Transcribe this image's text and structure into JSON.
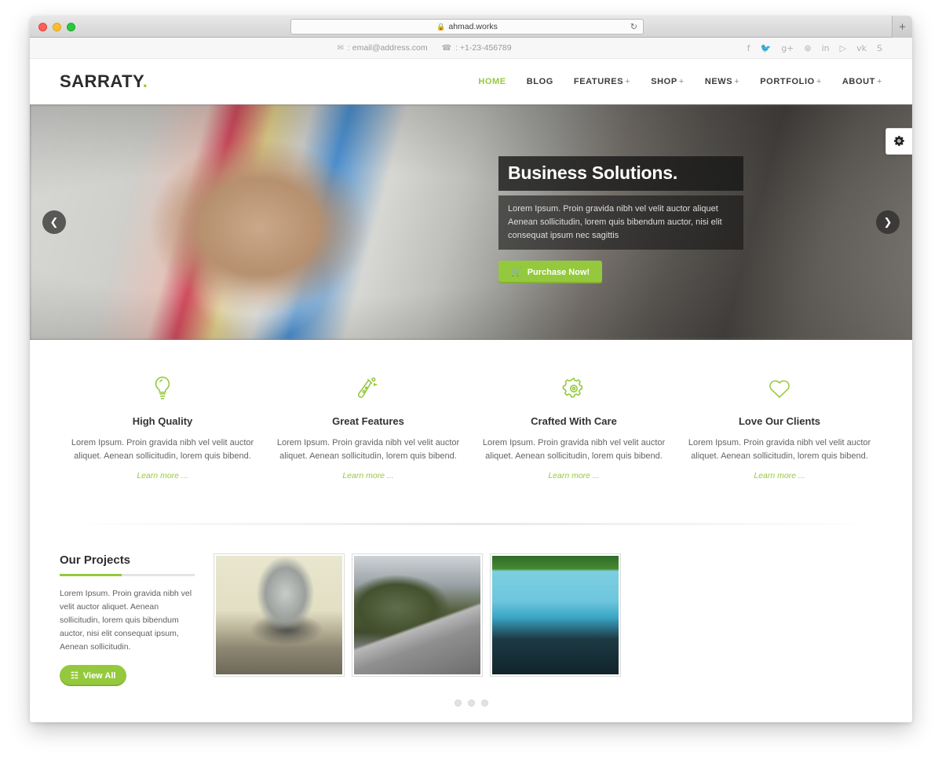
{
  "browser": {
    "url": "ahmad.works",
    "lock_icon": "lock-icon",
    "reload_icon": "reload-icon",
    "newtab_label": "+"
  },
  "topbar": {
    "email_icon": "envelope-icon",
    "email": ": email@address.com",
    "phone_icon": "phone-icon",
    "phone": ": +1-23-456789",
    "social": [
      {
        "name": "facebook-icon",
        "glyph": "f"
      },
      {
        "name": "twitter-icon",
        "glyph": "ᴠ"
      },
      {
        "name": "google-plus-icon",
        "glyph": "g+"
      },
      {
        "name": "dribbble-icon",
        "glyph": "⊛"
      },
      {
        "name": "linkedin-icon",
        "glyph": "in"
      },
      {
        "name": "youtube-icon",
        "glyph": "▷"
      },
      {
        "name": "vk-icon",
        "glyph": "vk"
      },
      {
        "name": "skype-icon",
        "glyph": "S"
      }
    ]
  },
  "header": {
    "logo": "SARRATY",
    "logo_dot": ".",
    "nav": [
      {
        "label": "HOME",
        "active": true,
        "dropdown": false
      },
      {
        "label": "BLOG",
        "active": false,
        "dropdown": false
      },
      {
        "label": "FEATURES",
        "active": false,
        "dropdown": true
      },
      {
        "label": "SHOP",
        "active": false,
        "dropdown": true
      },
      {
        "label": "NEWS",
        "active": false,
        "dropdown": true
      },
      {
        "label": "PORTFOLIO",
        "active": false,
        "dropdown": true
      },
      {
        "label": "ABOUT",
        "active": false,
        "dropdown": true
      }
    ],
    "dropdown_marker": "+"
  },
  "hero": {
    "title": "Business Solutions.",
    "description": "Lorem Ipsum. Proin gravida nibh vel velit auctor aliquet Aenean sollicitudin, lorem quis bibendum auctor, nisi elit consequat ipsum nec sagittis",
    "button_label": "Purchase Now!",
    "button_icon": "shopping-cart-icon",
    "prev_icon": "chevron-left-icon",
    "next_icon": "chevron-right-icon",
    "settings_icon": "gears-icon"
  },
  "features": [
    {
      "icon": "lightbulb-icon",
      "title": "High Quality",
      "text": "Lorem Ipsum. Proin gravida nibh vel velit auctor aliquet. Aenean sollicitudin, lorem quis bibend.",
      "link": "Learn more ..."
    },
    {
      "icon": "flask-icon",
      "title": "Great Features",
      "text": "Lorem Ipsum. Proin gravida nibh vel velit auctor aliquet. Aenean sollicitudin, lorem quis bibend.",
      "link": "Learn more ..."
    },
    {
      "icon": "gear-icon",
      "title": "Crafted With Care",
      "text": "Lorem Ipsum. Proin gravida nibh vel velit auctor aliquet. Aenean sollicitudin, lorem quis bibend.",
      "link": "Learn more ..."
    },
    {
      "icon": "heart-icon",
      "title": "Love Our Clients",
      "text": "Lorem Ipsum. Proin gravida nibh vel velit auctor aliquet. Aenean sollicitudin, lorem quis bibend.",
      "link": "Learn more ..."
    }
  ],
  "projects": {
    "title": "Our Projects",
    "text": "Lorem Ipsum. Proin gravida nibh vel velit auctor aliquet. Aenean sollicitudin, lorem quis bibendum auctor, nisi elit consequat ipsum, Aenean sollicitudin.",
    "button_label": "View All",
    "button_icon": "grid-list-icon",
    "thumbnails": [
      {
        "name": "project-thumb-kitchenware"
      },
      {
        "name": "project-thumb-mountain-road"
      },
      {
        "name": "project-thumb-underwater-car"
      }
    ],
    "pagination_dots": 3
  },
  "colors": {
    "accent_green": "#95c93d",
    "text_dark": "#2f2f2f",
    "text_body": "#646464",
    "topbar_bg": "#f7f7f7"
  }
}
